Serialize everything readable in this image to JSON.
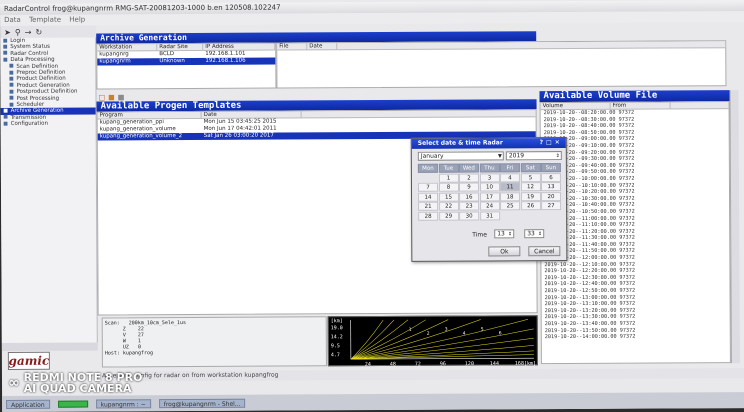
{
  "window": {
    "title": "RadarControl frog@kupangnrm RMG-SAT-20081203-1000 b.en 120508.102247",
    "menu": [
      "Data",
      "Template",
      "Help"
    ]
  },
  "nav": {
    "items": [
      {
        "label": "Login",
        "icon": "user-icon",
        "selected": false
      },
      {
        "label": "System Status",
        "icon": "globe-icon",
        "selected": false
      },
      {
        "label": "Radar Control",
        "icon": "radar-icon",
        "selected": false
      },
      {
        "label": "Data Processing",
        "icon": "folder-icon",
        "selected": false
      },
      {
        "label": "Scan Definition",
        "icon": "scan-icon",
        "selected": false
      },
      {
        "label": "Preproc Definition",
        "icon": "preproc-icon",
        "selected": false
      },
      {
        "label": "Product Definition",
        "icon": "product-icon",
        "selected": false
      },
      {
        "label": "Product Generation",
        "icon": "product-icon",
        "selected": false
      },
      {
        "label": "Postproduct Definition",
        "icon": "product-icon",
        "selected": false
      },
      {
        "label": "Post Processing",
        "icon": "product-icon",
        "selected": false
      },
      {
        "label": "Scheduler",
        "icon": "clock-icon",
        "selected": false
      },
      {
        "label": "Archive Generation",
        "icon": "archive-icon",
        "selected": true
      },
      {
        "label": "Transmission",
        "icon": "network-icon",
        "selected": false
      },
      {
        "label": "Configuration",
        "icon": "gear-icon",
        "selected": false
      }
    ]
  },
  "archive": {
    "title": "Archive Generation",
    "ws_columns": [
      "Workstation",
      "Radar Site",
      "IP Address"
    ],
    "ws_rows": [
      {
        "ws": "kupangnrg",
        "site": "BCLD",
        "ip": "192.168.1.101",
        "selected": false
      },
      {
        "ws": "kupangnrm",
        "site": "Unknown",
        "ip": "192.168.1.106",
        "selected": true
      }
    ],
    "file_columns": [
      "File",
      "Date"
    ]
  },
  "progen": {
    "title": "Available Progen Templates",
    "columns": [
      "Program",
      "Date"
    ],
    "rows": [
      {
        "name": "kupang_generation_ppi",
        "date": "Mon Jun 15 03:45:25 2015",
        "selected": false
      },
      {
        "name": "kupang_generation_volume",
        "date": "Mon Jun 17 04:42:01 2011",
        "selected": false
      },
      {
        "name": "kupang_generation_volume_2",
        "date": "Sat Jan 26 03:00:20 2017",
        "selected": true
      }
    ]
  },
  "volume": {
    "title": "Available Volume File",
    "columns": [
      "Volume",
      "From"
    ],
    "rows": [
      "2019-10-20--08:20:00.00 97372",
      "2019-10-20--08:30:00.00 97372",
      "2019-10-20--08:40:00.00 97372",
      "2019-10-20--08:50:00.00 97372",
      "2019-10-20--09:00:00.00 97372",
      "2019-10-20--09:10:00.00 97372",
      "2019-10-20--09:20:00.00 97372",
      "2019-10-20--09:30:00.00 97372",
      "2019-10-20--09:40:00.00 97372",
      "2019-10-20--09:50:00.00 97372",
      "2019-10-20--10:00:00.00 97372",
      "2019-10-20--10:10:00.00 97372",
      "2019-10-20--10:20:00.00 97372",
      "2019-10-20--10:30:00.00 97372",
      "2019-10-20--10:40:00.00 97372",
      "2019-10-20--10:50:00.00 97372",
      "2019-10-20--11:00:00.00 97372",
      "2019-10-20--11:10:00.00 97372",
      "2019-10-20--11:20:00.00 97372",
      "2019-10-20--11:30:00.00 97372",
      "2019-10-20--11:40:00.00 97372",
      "2019-10-20--11:50:00.00 97372",
      "2019-10-20--12:00:00.00 97372",
      "2019-10-20--12:10:00.00 97372",
      "2019-10-20--12:20:00.00 97372",
      "2019-10-20--12:30:00.00 97372",
      "2019-10-20--12:40:00.00 97372",
      "2019-10-20--12:50:00.00 97372",
      "2019-10-20--13:00:00.00 97372",
      "2019-10-20--13:10:00.00 97372",
      "2019-10-20--13:20:00.00 97372",
      "2019-10-20--13:30:00.00 97372",
      "2019-10-20--13:40:00.00 97372",
      "2019-10-20--13:50:00.00 97372",
      "2019-10-20--14:00:00.00 97372"
    ]
  },
  "scan_info": {
    "lines": [
      "Scan:   200km_10cm_5ele_1us",
      "      Z    22",
      "      V    27",
      "      W    1",
      "      UZ   0",
      "Host: kupangfrog"
    ]
  },
  "range_chart": {
    "unit_label": "[km]",
    "y_ticks": [
      "19.0",
      "14.2",
      "9.5",
      "4.7"
    ],
    "x_ticks": [
      "24",
      "48",
      "72",
      "96",
      "120",
      "144",
      "168[km]"
    ],
    "elevation_marks": [
      "1",
      "2",
      "3",
      "4",
      "5",
      "6"
    ],
    "line_color": "#e8e020",
    "axis_color": "#ffffff"
  },
  "dialog": {
    "title": "Select date & time Radar",
    "month": "January",
    "year": "2019",
    "weekdays": [
      "Mon",
      "Tue",
      "Wed",
      "Thu",
      "Fri",
      "Sat",
      "Sun"
    ],
    "weeks": [
      [
        "",
        "1",
        "2",
        "3",
        "4",
        "5",
        "6"
      ],
      [
        "7",
        "8",
        "9",
        "10",
        "11",
        "12",
        "13"
      ],
      [
        "14",
        "15",
        "16",
        "17",
        "18",
        "19",
        "20"
      ],
      [
        "21",
        "22",
        "23",
        "24",
        "25",
        "26",
        "27"
      ],
      [
        "28",
        "29",
        "30",
        "31",
        "",
        "",
        ""
      ]
    ],
    "today": "11",
    "time_label": "Time",
    "hour": "13",
    "minute": "33",
    "ok_label": "Ok",
    "cancel_label": "Cancel"
  },
  "logo": "gamic",
  "status": "Accepting config for radar on from workstation kupangfrog",
  "taskbar": {
    "items": [
      "Application",
      "kupangnrm : ~",
      "frog@kupangnrm - Shel..."
    ]
  },
  "watermark": {
    "line1": "REDMI NOTE 8 PRO",
    "line2": "AI QUAD CAMERA"
  }
}
